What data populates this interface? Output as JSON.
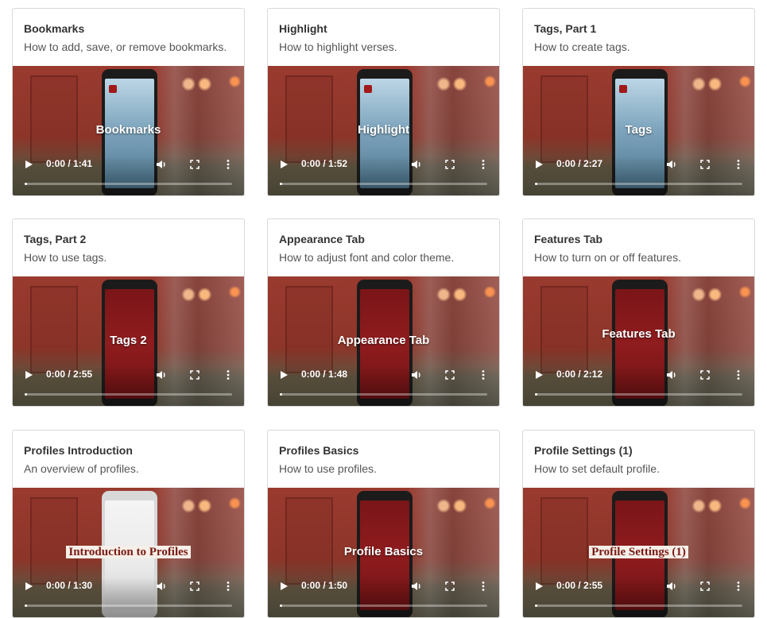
{
  "cards": [
    {
      "title": "Bookmarks",
      "description": "How to add, save, or remove bookmarks.",
      "overlay": "Bookmarks",
      "time": "0:00 / 1:41",
      "screen": "blue"
    },
    {
      "title": "Highlight",
      "description": "How to highlight verses.",
      "overlay": "Highlight",
      "time": "0:00 / 1:52",
      "screen": "blue"
    },
    {
      "title": "Tags, Part 1",
      "description": "How to create tags.",
      "overlay": "Tags",
      "time": "0:00 / 2:27",
      "screen": "blue"
    },
    {
      "title": "Tags, Part 2",
      "description": "How to use tags.",
      "overlay": "Tags 2",
      "time": "0:00 / 2:55",
      "screen": "red"
    },
    {
      "title": "Appearance Tab",
      "description": "How to adjust font and color theme.",
      "overlay": "Appearance Tab",
      "time": "0:00 / 1:48",
      "screen": "red"
    },
    {
      "title": "Features Tab",
      "description": "How to turn on or off features.",
      "overlay": "Features Tab",
      "time": "0:00 / 2:12",
      "screen": "red"
    },
    {
      "title": "Profiles Introduction",
      "description": "An overview of profiles.",
      "overlay": "Introduction to Profiles",
      "time": "0:00 / 1:30",
      "screen": "white",
      "boxed": true
    },
    {
      "title": "Profiles Basics",
      "description": "How to use profiles.",
      "overlay": "Profile Basics",
      "time": "0:00 / 1:50",
      "screen": "red"
    },
    {
      "title": "Profile Settings (1)",
      "description": "How to set default profile.",
      "overlay": "Profile Settings (1)",
      "time": "0:00 / 2:55",
      "screen": "red",
      "boxed": true
    }
  ],
  "icons": {
    "play": "play-icon",
    "volume": "volume-icon",
    "fullscreen": "fullscreen-icon",
    "more": "more-options-icon"
  },
  "colors": {
    "card_border": "#d9d9d9",
    "title": "#333333",
    "description": "#555555",
    "overlay_box": "#f5efe8",
    "overlay_box_text": "#7a1a14"
  }
}
